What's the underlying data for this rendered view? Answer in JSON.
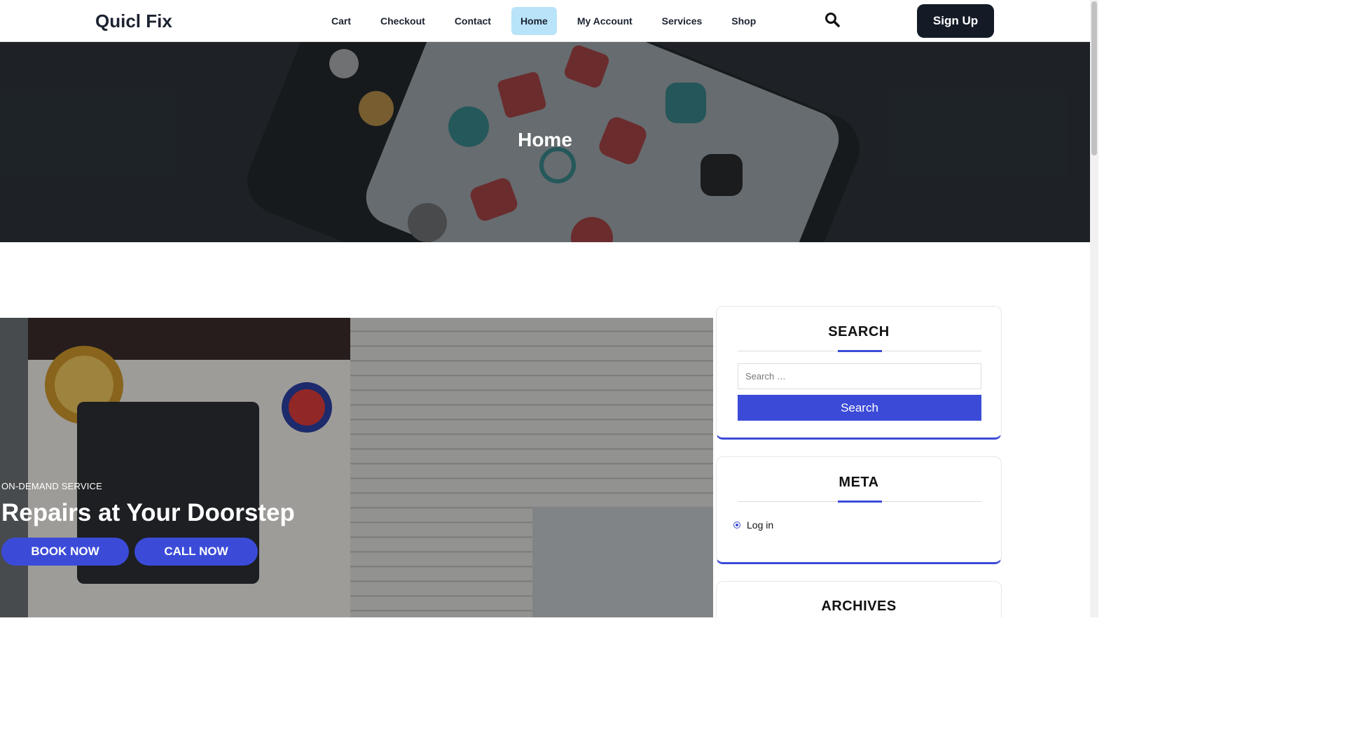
{
  "header": {
    "logo": "Quicl Fix",
    "nav": [
      "Cart",
      "Checkout",
      "Contact",
      "Home",
      "My Account",
      "Services",
      "Shop"
    ],
    "active_nav": "Home",
    "search_icon": "search-icon",
    "signup_label": "Sign Up"
  },
  "hero": {
    "title": "Home"
  },
  "slider": {
    "kicker": "ON-DEMAND SERVICE",
    "title": "Repairs at Your Doorstep",
    "book_label": "BOOK NOW",
    "call_label": "CALL NOW"
  },
  "sidebar": {
    "search": {
      "title": "SEARCH",
      "placeholder": "Search …",
      "button_label": "Search"
    },
    "meta": {
      "title": "META",
      "items": [
        "Log in"
      ]
    },
    "archives": {
      "title": "ARCHIVES"
    }
  },
  "colors": {
    "accent": "#3b4bd8",
    "active_nav_bg": "#b9e3f8",
    "signup_bg": "#141b27"
  }
}
